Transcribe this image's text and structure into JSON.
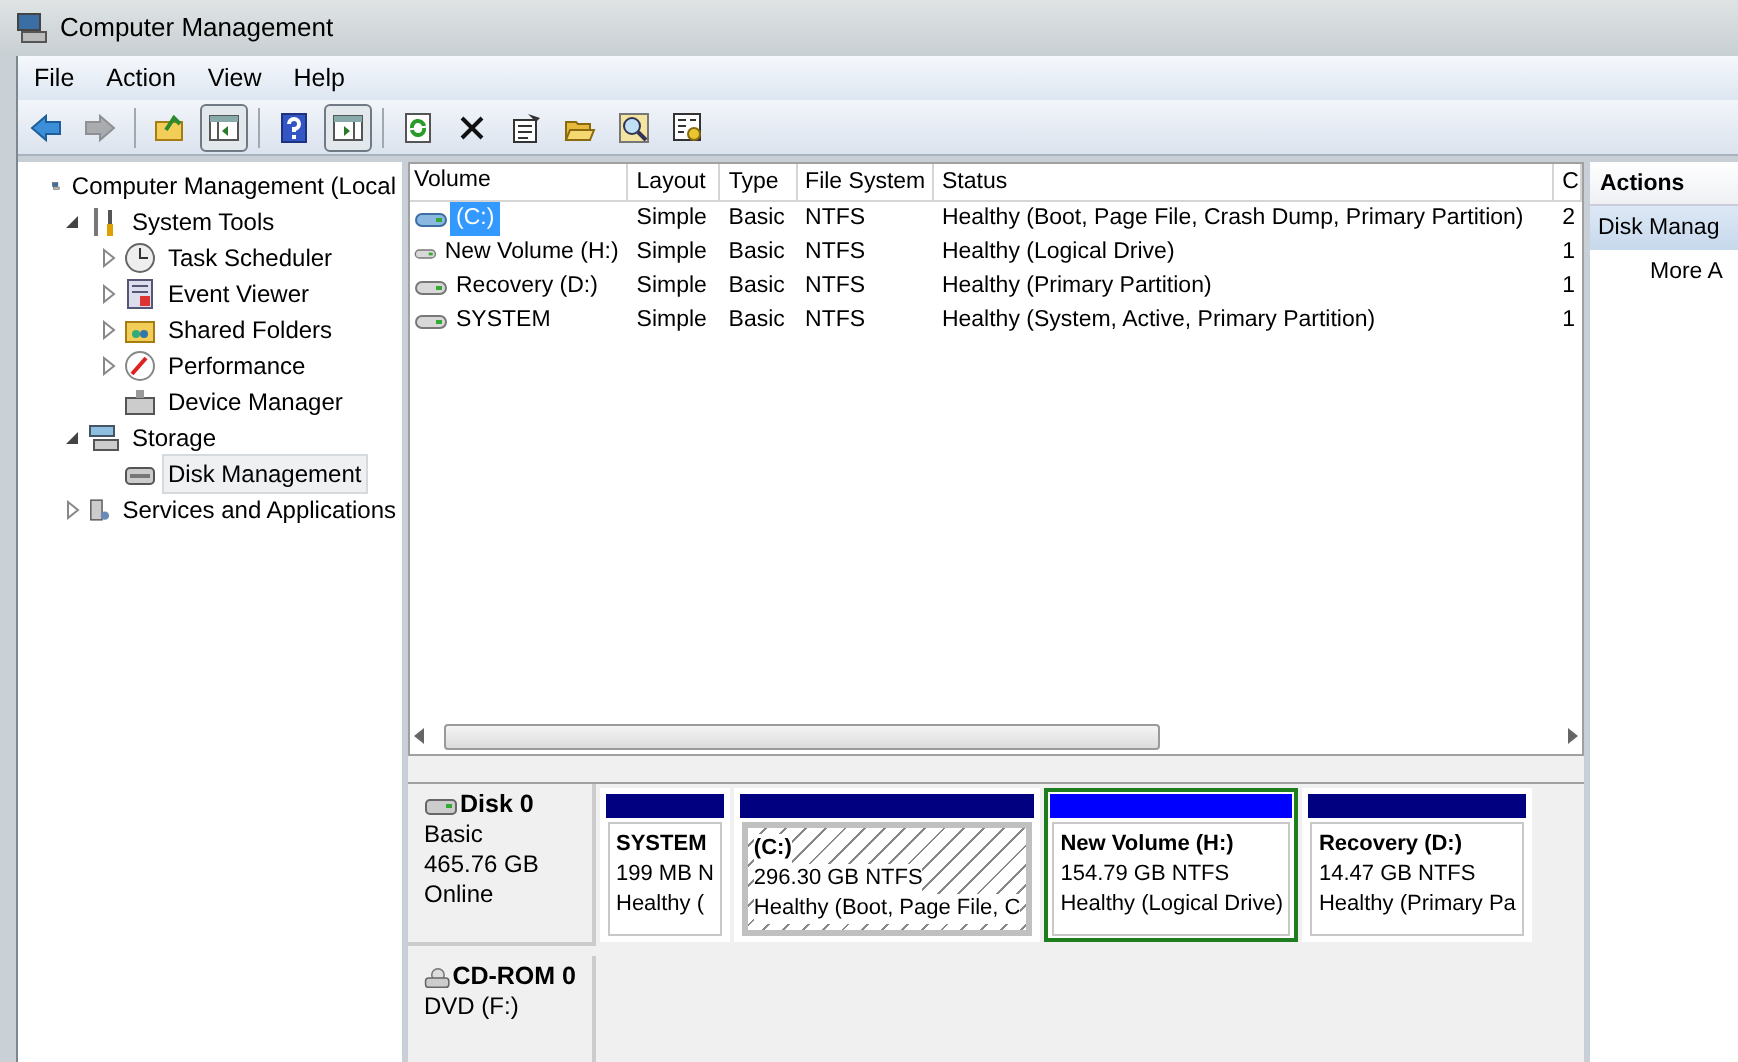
{
  "window": {
    "title": "Computer Management"
  },
  "menu": [
    "File",
    "Action",
    "View",
    "Help"
  ],
  "toolbar": [
    {
      "kind": "back",
      "pressed": false,
      "disabled": false
    },
    {
      "kind": "forward",
      "pressed": false,
      "disabled": true
    },
    {
      "kind": "separator"
    },
    {
      "kind": "up",
      "pressed": false,
      "disabled": false
    },
    {
      "kind": "tree-pane",
      "pressed": true,
      "disabled": false
    },
    {
      "kind": "separator"
    },
    {
      "kind": "help",
      "pressed": false,
      "disabled": false
    },
    {
      "kind": "action-pane",
      "pressed": true,
      "disabled": false
    },
    {
      "kind": "separator"
    },
    {
      "kind": "refresh",
      "pressed": false,
      "disabled": false
    },
    {
      "kind": "delete",
      "pressed": false,
      "disabled": false
    },
    {
      "kind": "properties",
      "pressed": false,
      "disabled": false
    },
    {
      "kind": "open",
      "pressed": false,
      "disabled": false
    },
    {
      "kind": "search",
      "pressed": false,
      "disabled": false
    },
    {
      "kind": "settings",
      "pressed": false,
      "disabled": false
    }
  ],
  "tree": [
    {
      "label": "Computer Management (Local",
      "selected": false,
      "children": [
        {
          "label": "System Tools",
          "expanded": true,
          "selected": false,
          "children": [
            {
              "label": "Task Scheduler",
              "expanded": false,
              "selected": false
            },
            {
              "label": "Event Viewer",
              "expanded": false,
              "selected": false
            },
            {
              "label": "Shared Folders",
              "expanded": false,
              "selected": false
            },
            {
              "label": "Performance",
              "expanded": false,
              "selected": false
            },
            {
              "label": "Device Manager",
              "selected": false
            }
          ]
        },
        {
          "label": "Storage",
          "expanded": true,
          "selected": false,
          "children": [
            {
              "label": "Disk Management",
              "selected": true
            }
          ]
        },
        {
          "label": "Services and Applications",
          "expanded": false,
          "selected": false
        }
      ]
    }
  ],
  "table": {
    "columns": [
      "Volume",
      "Layout",
      "Type",
      "File System",
      "Status",
      "C"
    ],
    "rows": [
      {
        "selected": true,
        "cells": [
          "(C:)",
          "Simple",
          "Basic",
          "NTFS",
          "Healthy (Boot, Page File, Crash Dump, Primary Partition)",
          "2"
        ]
      },
      {
        "selected": false,
        "cells": [
          "New Volume (H:)",
          "Simple",
          "Basic",
          "NTFS",
          "Healthy (Logical Drive)",
          "1"
        ]
      },
      {
        "selected": false,
        "cells": [
          "Recovery (D:)",
          "Simple",
          "Basic",
          "NTFS",
          "Healthy (Primary Partition)",
          "1"
        ]
      },
      {
        "selected": false,
        "cells": [
          "SYSTEM",
          "Simple",
          "Basic",
          "NTFS",
          "Healthy (System, Active, Primary Partition)",
          "1"
        ]
      }
    ]
  },
  "disks": [
    {
      "kind": "disk",
      "name": "Disk 0",
      "lines": [
        "Basic",
        "465.76 GB",
        "Online"
      ],
      "partitions": [
        {
          "name": "SYSTEM",
          "size": "199 MB N",
          "status": "Healthy (",
          "color": "#000080",
          "selected": false,
          "logical": false
        },
        {
          "name": "(C:)",
          "size": "296.30 GB NTFS",
          "status": "Healthy (Boot, Page File, C",
          "color": "#000080",
          "selected": true,
          "logical": false
        },
        {
          "name": "New Volume  (H:)",
          "size": "154.79 GB NTFS",
          "status": "Healthy (Logical Drive)",
          "color": "#0000ff",
          "selected": false,
          "logical": true
        },
        {
          "name": "Recovery  (D:)",
          "size": "14.47 GB NTFS",
          "status": "Healthy (Primary Pa",
          "color": "#000080",
          "selected": false,
          "logical": false
        }
      ]
    },
    {
      "kind": "cdrom",
      "name": "CD-ROM 0",
      "lines": [
        "DVD (F:)"
      ]
    }
  ],
  "actions": {
    "title": "Actions",
    "items": [
      {
        "label": "Disk Manag",
        "selected": true,
        "kind": "group"
      },
      {
        "label": "More A",
        "selected": false,
        "kind": "item"
      }
    ]
  }
}
